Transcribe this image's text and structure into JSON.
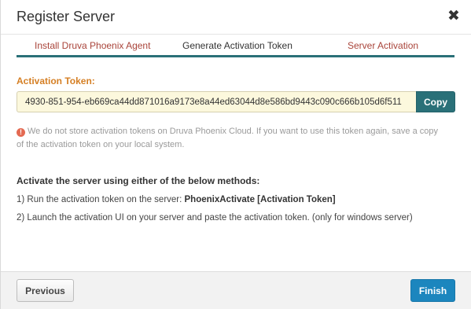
{
  "dialog": {
    "title": "Register Server",
    "close_icon": "close-icon"
  },
  "steps": [
    {
      "label": "Install Druva Phoenix Agent",
      "state": "done"
    },
    {
      "label": "Generate Activation Token",
      "state": "current"
    },
    {
      "label": "Server Activation",
      "state": "done"
    }
  ],
  "token": {
    "label": "Activation Token:",
    "value": "4930-851-954-eb669ca44dd871016a9173e8a44ed63044d8e586bd9443c090c666b105d6f511",
    "copy_label": "Copy"
  },
  "note": {
    "icon": "info-icon",
    "text": "We do not store activation tokens on Druva Phoenix Cloud. If you want to use this token again, save a copy of the activation token on your local system."
  },
  "methods": {
    "title": "Activate the server using either of the below methods:",
    "method1_prefix": "1) Run the activation token on the server: ",
    "method1_command": "PhoenixActivate [Activation Token]",
    "method2": "2) Launch the activation UI on your server and paste the activation token. (only for windows server)"
  },
  "footer": {
    "previous_label": "Previous",
    "finish_label": "Finish"
  },
  "colors": {
    "accent": "#2a7078",
    "primary_button": "#1c86be",
    "step_link": "#a9443a",
    "field_label": "#d57f24",
    "token_background": "#fcf8dd",
    "info_icon": "#e46a52"
  }
}
